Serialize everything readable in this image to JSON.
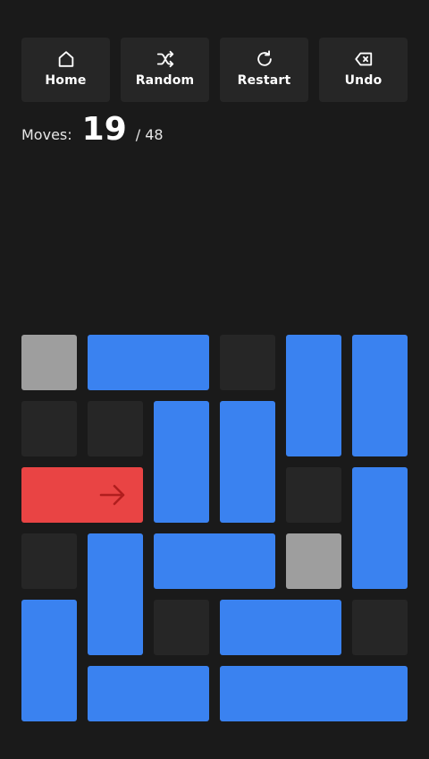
{
  "toolbar": {
    "buttons": [
      {
        "id": "home",
        "label": "Home",
        "icon": "home-icon"
      },
      {
        "id": "random",
        "label": "Random",
        "icon": "shuffle-icon"
      },
      {
        "id": "restart",
        "label": "Restart",
        "icon": "restart-icon"
      },
      {
        "id": "undo",
        "label": "Undo",
        "icon": "undo-backspace-icon"
      }
    ]
  },
  "moves": {
    "label": "Moves:",
    "count": "19",
    "total": "/ 48"
  },
  "board": {
    "rows": 6,
    "cols": 6,
    "walls": [
      [
        0,
        0
      ],
      [
        3,
        4
      ]
    ],
    "target": {
      "row": 2,
      "col": 0,
      "len": 2,
      "dir": "h",
      "icon": "arrow-right-icon"
    },
    "blocks": [
      {
        "row": 0,
        "col": 1,
        "len": 2,
        "dir": "h"
      },
      {
        "row": 0,
        "col": 4,
        "len": 2,
        "dir": "v"
      },
      {
        "row": 0,
        "col": 5,
        "len": 2,
        "dir": "v"
      },
      {
        "row": 1,
        "col": 2,
        "len": 2,
        "dir": "v"
      },
      {
        "row": 1,
        "col": 3,
        "len": 2,
        "dir": "v"
      },
      {
        "row": 2,
        "col": 5,
        "len": 2,
        "dir": "v"
      },
      {
        "row": 3,
        "col": 1,
        "len": 2,
        "dir": "v"
      },
      {
        "row": 3,
        "col": 2,
        "len": 2,
        "dir": "h"
      },
      {
        "row": 4,
        "col": 0,
        "len": 2,
        "dir": "v"
      },
      {
        "row": 4,
        "col": 3,
        "len": 2,
        "dir": "h"
      },
      {
        "row": 5,
        "col": 1,
        "len": 2,
        "dir": "h"
      },
      {
        "row": 5,
        "col": 3,
        "len": 3,
        "dir": "h"
      }
    ],
    "colors": {
      "background": "#1a1a1a",
      "empty": "#262626",
      "wall": "#9e9e9e",
      "block": "#3a82f0",
      "target": "#e94444",
      "arrow": "#b01e1e"
    }
  }
}
